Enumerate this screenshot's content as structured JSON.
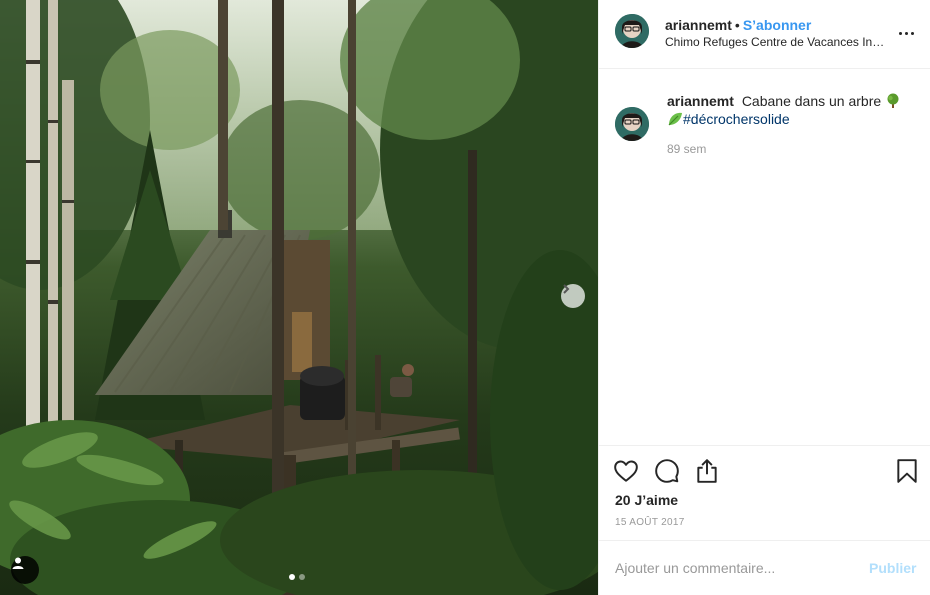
{
  "post": {
    "username": "ariannemt",
    "separator": "•",
    "follow_label": "S’abonner",
    "location": "Chimo Refuges Centre de Vacances Insolites",
    "caption_text": "Cabane dans un arbre",
    "caption_hashtag": "#décrochersolide",
    "relative_time": "89 sem",
    "likes": "20 J’aime",
    "date": "15 AOÛT 2017",
    "comment_placeholder": "Ajouter un commentaire...",
    "publish_label": "Publier",
    "carousel": {
      "slides": 2,
      "active": 1
    }
  },
  "icons": {
    "more": "more-horizontal-icon",
    "like": "heart-icon",
    "comment": "comment-bubble-icon",
    "share": "share-icon",
    "save": "bookmark-icon",
    "next": "chevron-right-icon",
    "tagged": "user-tag-icon"
  },
  "colors": {
    "link_blue": "#3897f0",
    "hashtag_blue": "#003569",
    "muted_gray": "#999999",
    "publish_disabled": "#b2dffc",
    "divider": "#efefef"
  }
}
